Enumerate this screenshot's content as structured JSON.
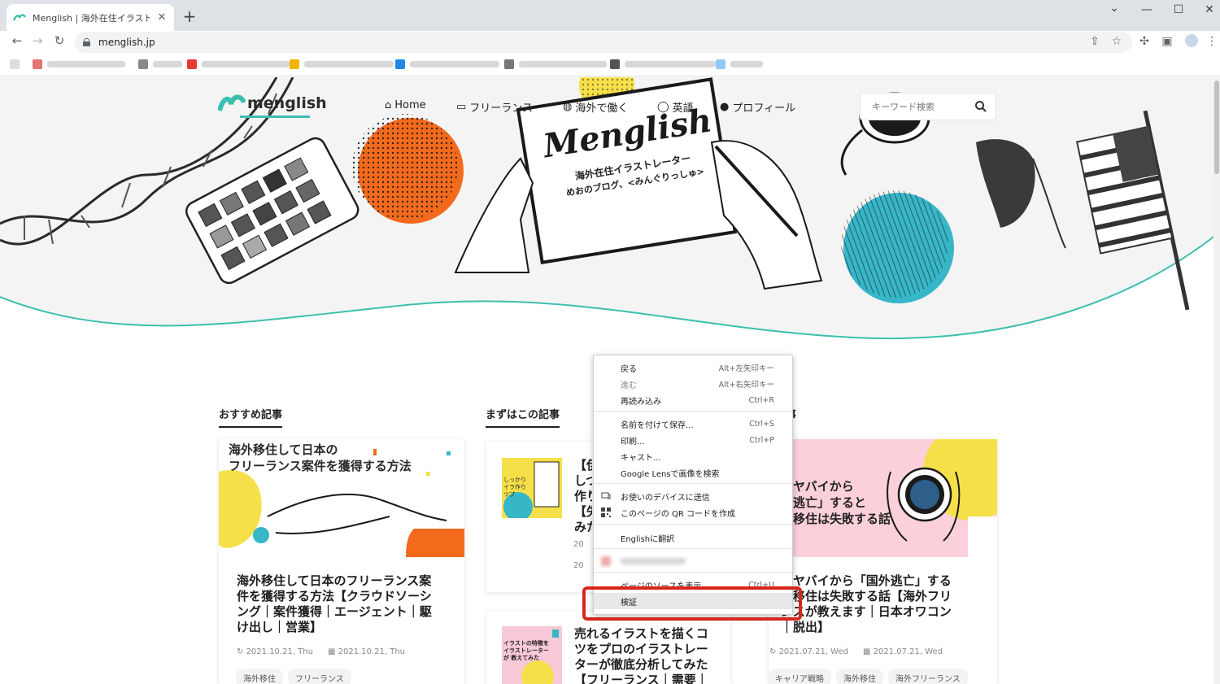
{
  "browser": {
    "tab_title": "Menglish | 海外在住イラストレーター",
    "tab_close": "✕",
    "new_tab": "+",
    "url": "menglish.jp",
    "window_controls": {
      "minimize": "—",
      "maximize": "☐",
      "close": "✕",
      "dropdown": "⌄"
    }
  },
  "site": {
    "logo": "menglish",
    "nav": [
      {
        "icon": "home-icon",
        "label": "Home"
      },
      {
        "icon": "laptop-icon",
        "label": "フリーランス"
      },
      {
        "icon": "globe-icon",
        "label": "海外で働く"
      },
      {
        "icon": "chat-icon",
        "label": "英語"
      },
      {
        "icon": "user-icon",
        "label": "プロフィール"
      }
    ],
    "search_placeholder": "キーワード検索",
    "hero": {
      "note_title": "Menglish",
      "note_line1": "海外在住イラストレーター",
      "note_line2": "めおのブログ、<みんぐりっしゅ>"
    }
  },
  "sections": [
    {
      "heading": "おすすめ記事"
    },
    {
      "heading": "まずはこの記事"
    },
    {
      "heading": "事"
    }
  ],
  "posts": {
    "left": {
      "thumb_line1": "海外移住して日本の",
      "thumb_line2": "フリーランス案件を獲得する方法",
      "title": "海外移住して日本のフリーランス案件を獲得する方法【クラウドソーシング｜案件獲得｜エージェント｜駆け出し｜営業】",
      "date_updated": "2021.10.21, Thu",
      "date_published": "2021.10.21, Thu",
      "tags": [
        "海外移住",
        "フリーランス"
      ]
    },
    "middle_top": {
      "thumb_text": "しっかりイラ作りツプ",
      "title_fragment": "【伊\nしつ\n作り\n【失\nみた",
      "date1": "20",
      "date2": "20"
    },
    "middle_bottom": {
      "thumb_text": "イラストの特徴を イラストレーターが 教えてみた",
      "title": "売れるイラストを描くコツをプロのイラストレーターが徹底分析してみた【フリーランス｜需要｜"
    },
    "right": {
      "thumb_line1": "ヤバイから",
      "thumb_line2": "逃亡」すると",
      "thumb_line3": "移住は失敗する話",
      "title": "がヤバイから「国外逃亡」する\n外移住は失敗する話【海外フリ\nンスが教えます｜日本オワコン\n｜脱出】",
      "date_updated": "2021.07.21, Wed",
      "date_published": "2021.07.21, Wed",
      "tags": [
        "キャリア戦略",
        "海外移住",
        "海外フリーランス"
      ]
    }
  },
  "context_menu": {
    "items": [
      {
        "label": "戻る",
        "shortcut": "Alt+左矢印キー"
      },
      {
        "label": "進む",
        "shortcut": "Alt+右矢印キー"
      },
      {
        "label": "再読み込み",
        "shortcut": "Ctrl+R"
      },
      {
        "label": "名前を付けて保存...",
        "shortcut": "Ctrl+S"
      },
      {
        "label": "印刷...",
        "shortcut": "Ctrl+P"
      },
      {
        "label": "キャスト...",
        "shortcut": ""
      },
      {
        "label": "Google Lensで画像を検索",
        "shortcut": ""
      },
      {
        "label": "お使いのデバイスに送信",
        "shortcut": ""
      },
      {
        "label": "このページの QR コードを作成",
        "shortcut": ""
      },
      {
        "label": "Englishに翻訳",
        "shortcut": ""
      },
      {
        "label": "ページのソースを表示",
        "shortcut": "Ctrl+U"
      },
      {
        "label": "検証",
        "shortcut": ""
      }
    ]
  },
  "colors": {
    "accent_teal": "#3cbfae",
    "hero_orange": "#f36a1d",
    "hero_blue": "#37b6c8",
    "yellow": "#f6e04a",
    "highlight_red": "#d7261d"
  }
}
